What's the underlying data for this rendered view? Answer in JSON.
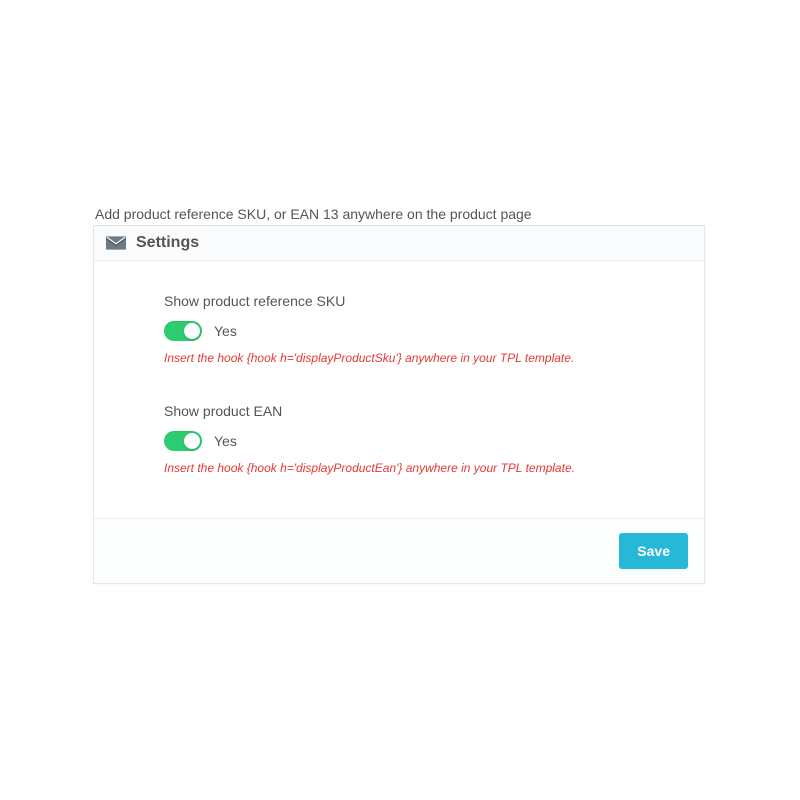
{
  "intro": "Add product reference SKU, or EAN 13 anywhere on the product page",
  "panel": {
    "title": "Settings"
  },
  "fields": {
    "sku": {
      "label": "Show product reference SKU",
      "state_text": "Yes",
      "help": "Insert the hook {hook h='displayProductSku'} anywhere in your TPL template."
    },
    "ean": {
      "label": "Show product EAN",
      "state_text": "Yes",
      "help": "Insert the hook {hook h='displayProductEan'} anywhere in your TPL template."
    }
  },
  "footer": {
    "save_label": "Save"
  }
}
